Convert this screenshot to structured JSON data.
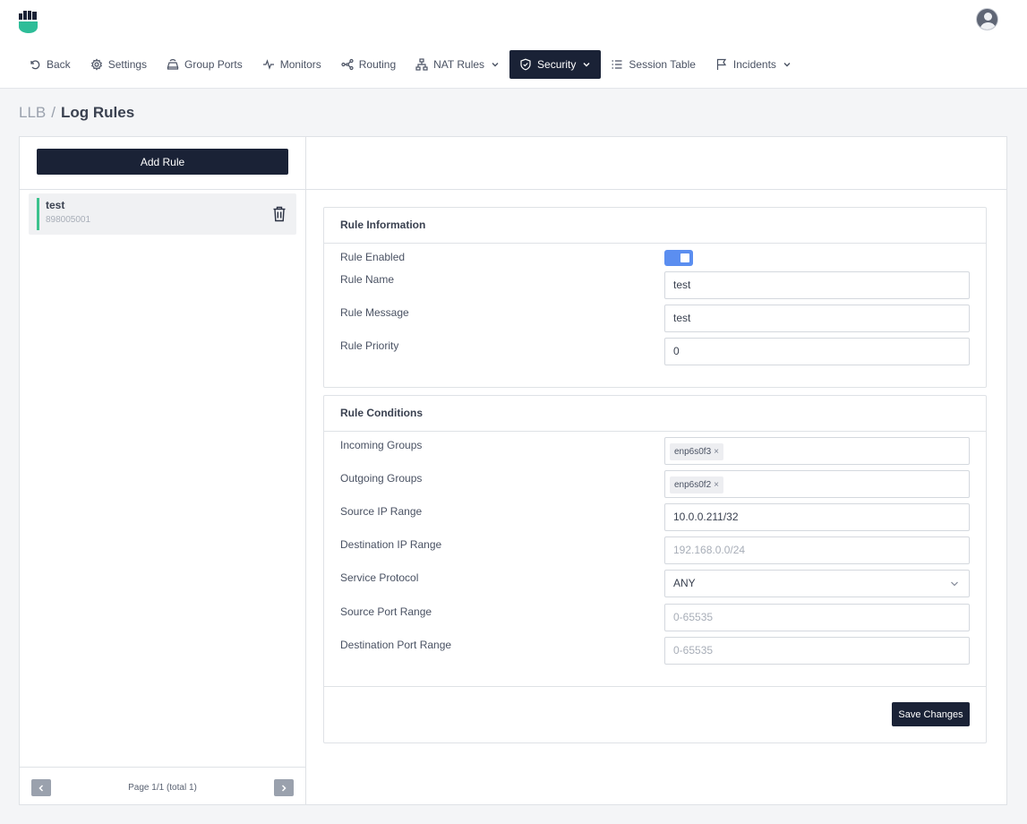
{
  "nav": {
    "items": [
      {
        "label": "Back",
        "icon": "undo-icon"
      },
      {
        "label": "Settings",
        "icon": "gear-icon"
      },
      {
        "label": "Group Ports",
        "icon": "router-icon"
      },
      {
        "label": "Monitors",
        "icon": "pulse-icon"
      },
      {
        "label": "Routing",
        "icon": "routing-icon"
      },
      {
        "label": "NAT Rules",
        "icon": "network-icon",
        "dropdown": true
      },
      {
        "label": "Security",
        "icon": "shield-icon",
        "dropdown": true,
        "active": true
      },
      {
        "label": "Session Table",
        "icon": "list-icon"
      },
      {
        "label": "Incidents",
        "icon": "flag-icon",
        "dropdown": true
      }
    ]
  },
  "breadcrumb": {
    "root": "LLB",
    "separator": "/",
    "current": "Log Rules"
  },
  "sidebar": {
    "add_label": "Add Rule",
    "rules": [
      {
        "name": "test",
        "id": "898005001"
      }
    ],
    "pagination": "Page 1/1 (total 1)"
  },
  "rule_info": {
    "title": "Rule Information",
    "enabled_label": "Rule Enabled",
    "enabled": true,
    "name_label": "Rule Name",
    "name_value": "test",
    "message_label": "Rule Message",
    "message_value": "test",
    "priority_label": "Rule Priority",
    "priority_value": "0"
  },
  "rule_conditions": {
    "title": "Rule Conditions",
    "incoming_label": "Incoming Groups",
    "incoming_tag": "enp6s0f3",
    "outgoing_label": "Outgoing Groups",
    "outgoing_tag": "enp6s0f2",
    "tag_remove": "×",
    "src_ip_label": "Source IP Range",
    "src_ip_value": "10.0.0.211/32",
    "dst_ip_label": "Destination IP Range",
    "dst_ip_placeholder": "192.168.0.0/24",
    "protocol_label": "Service Protocol",
    "protocol_value": "ANY",
    "src_port_label": "Source Port Range",
    "src_port_placeholder": "0-65535",
    "dst_port_label": "Destination Port Range",
    "dst_port_placeholder": "0-65535",
    "save_label": "Save Changes"
  },
  "colors": {
    "accent": "#1a2236",
    "toggle": "#5b8ef0",
    "brand": "#3cc28d"
  }
}
